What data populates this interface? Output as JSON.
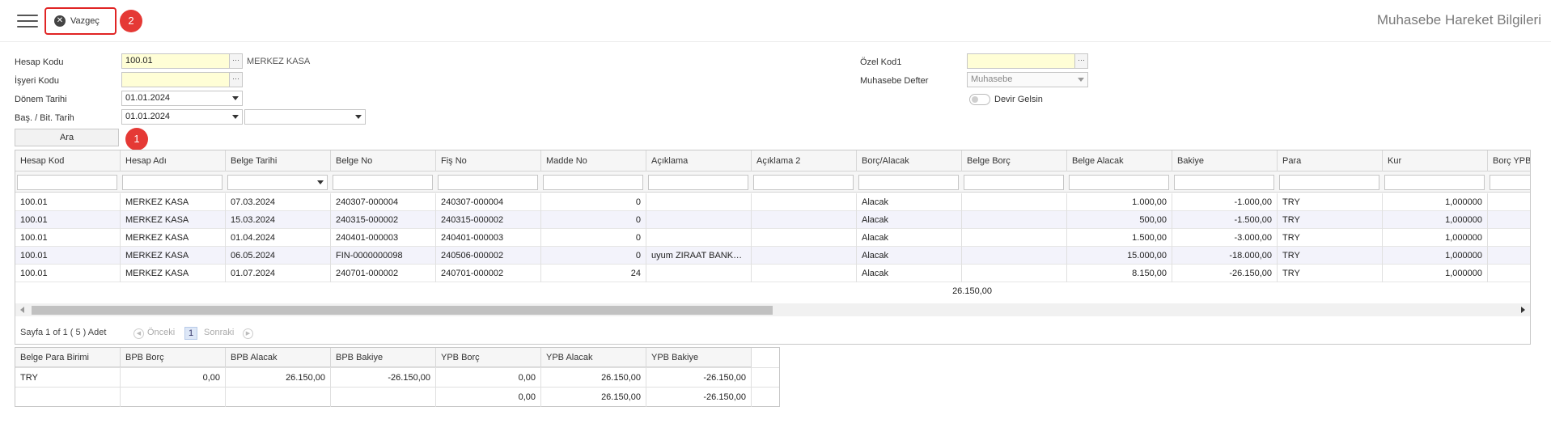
{
  "header": {
    "title": "Muhasebe Hareket Bilgileri",
    "cancel_label": "Vazgeç",
    "badge_cancel": "2",
    "badge_search": "1"
  },
  "form": {
    "hesap_kodu_label": "Hesap Kodu",
    "hesap_kodu_value": "100.01",
    "hesap_kodu_desc": "MERKEZ KASA",
    "isyeri_kodu_label": "İşyeri Kodu",
    "isyeri_kodu_value": "",
    "donem_tarihi_label": "Dönem Tarihi",
    "donem_tarihi_value": "01.01.2024",
    "bas_bit_label": "Baş. / Bit. Tarih",
    "bas_tarih_value": "01.01.2024",
    "bit_tarih_value": "",
    "ozel_kod_label": "Özel Kod1",
    "ozel_kod_value": "",
    "defter_label": "Muhasebe Defter",
    "defter_value": "Muhasebe",
    "devir_label": "Devir Gelsin",
    "search_label": "Ara"
  },
  "grid": {
    "columns": [
      "Hesap Kod",
      "Hesap Adı",
      "Belge Tarihi",
      "Belge No",
      "Fiş No",
      "Madde No",
      "Açıklama",
      "Açıklama 2",
      "Borç/Alacak",
      "Belge Borç",
      "Belge Alacak",
      "Bakiye",
      "Para",
      "Kur",
      "Borç YPB"
    ],
    "rows": [
      [
        "100.01",
        "MERKEZ KASA",
        "07.03.2024",
        "240307-000004",
        "240307-000004",
        "0",
        "",
        "",
        "Alacak",
        "",
        "1.000,00",
        "-1.000,00",
        "TRY",
        "1,000000",
        ""
      ],
      [
        "100.01",
        "MERKEZ KASA",
        "15.03.2024",
        "240315-000002",
        "240315-000002",
        "0",
        "",
        "",
        "Alacak",
        "",
        "500,00",
        "-1.500,00",
        "TRY",
        "1,000000",
        ""
      ],
      [
        "100.01",
        "MERKEZ KASA",
        "01.04.2024",
        "240401-000003",
        "240401-000003",
        "0",
        "",
        "",
        "Alacak",
        "",
        "1.500,00",
        "-3.000,00",
        "TRY",
        "1,000000",
        ""
      ],
      [
        "100.01",
        "MERKEZ KASA",
        "06.05.2024",
        "FIN-0000000098",
        "240506-000002",
        "0",
        "uyum ZIRAAT BANKASI",
        "",
        "Alacak",
        "",
        "15.000,00",
        "-18.000,00",
        "TRY",
        "1,000000",
        ""
      ],
      [
        "100.01",
        "MERKEZ KASA",
        "01.07.2024",
        "240701-000002",
        "240701-000002",
        "24",
        "",
        "",
        "Alacak",
        "",
        "8.150,00",
        "-26.150,00",
        "TRY",
        "1,000000",
        ""
      ]
    ],
    "total_alacak": "26.150,00",
    "pager_text": "Sayfa 1 of 1 ( 5 ) Adet",
    "prev_label": "Önceki",
    "page_number": "1",
    "next_label": "Sonraki"
  },
  "summary": {
    "columns": [
      "Belge Para Birimi",
      "BPB Borç",
      "BPB Alacak",
      "BPB Bakiye",
      "YPB Borç",
      "YPB Alacak",
      "YPB Bakiye"
    ],
    "rows": [
      [
        "TRY",
        "0,00",
        "26.150,00",
        "-26.150,00",
        "0,00",
        "26.150,00",
        "-26.150,00"
      ]
    ],
    "totals": [
      "",
      "",
      "",
      "",
      "0,00",
      "26.150,00",
      "-26.150,00"
    ]
  },
  "colors": {
    "badge": "#e53935",
    "input_highlight": "#fffed6",
    "row_alt": "#f3f3fb"
  }
}
